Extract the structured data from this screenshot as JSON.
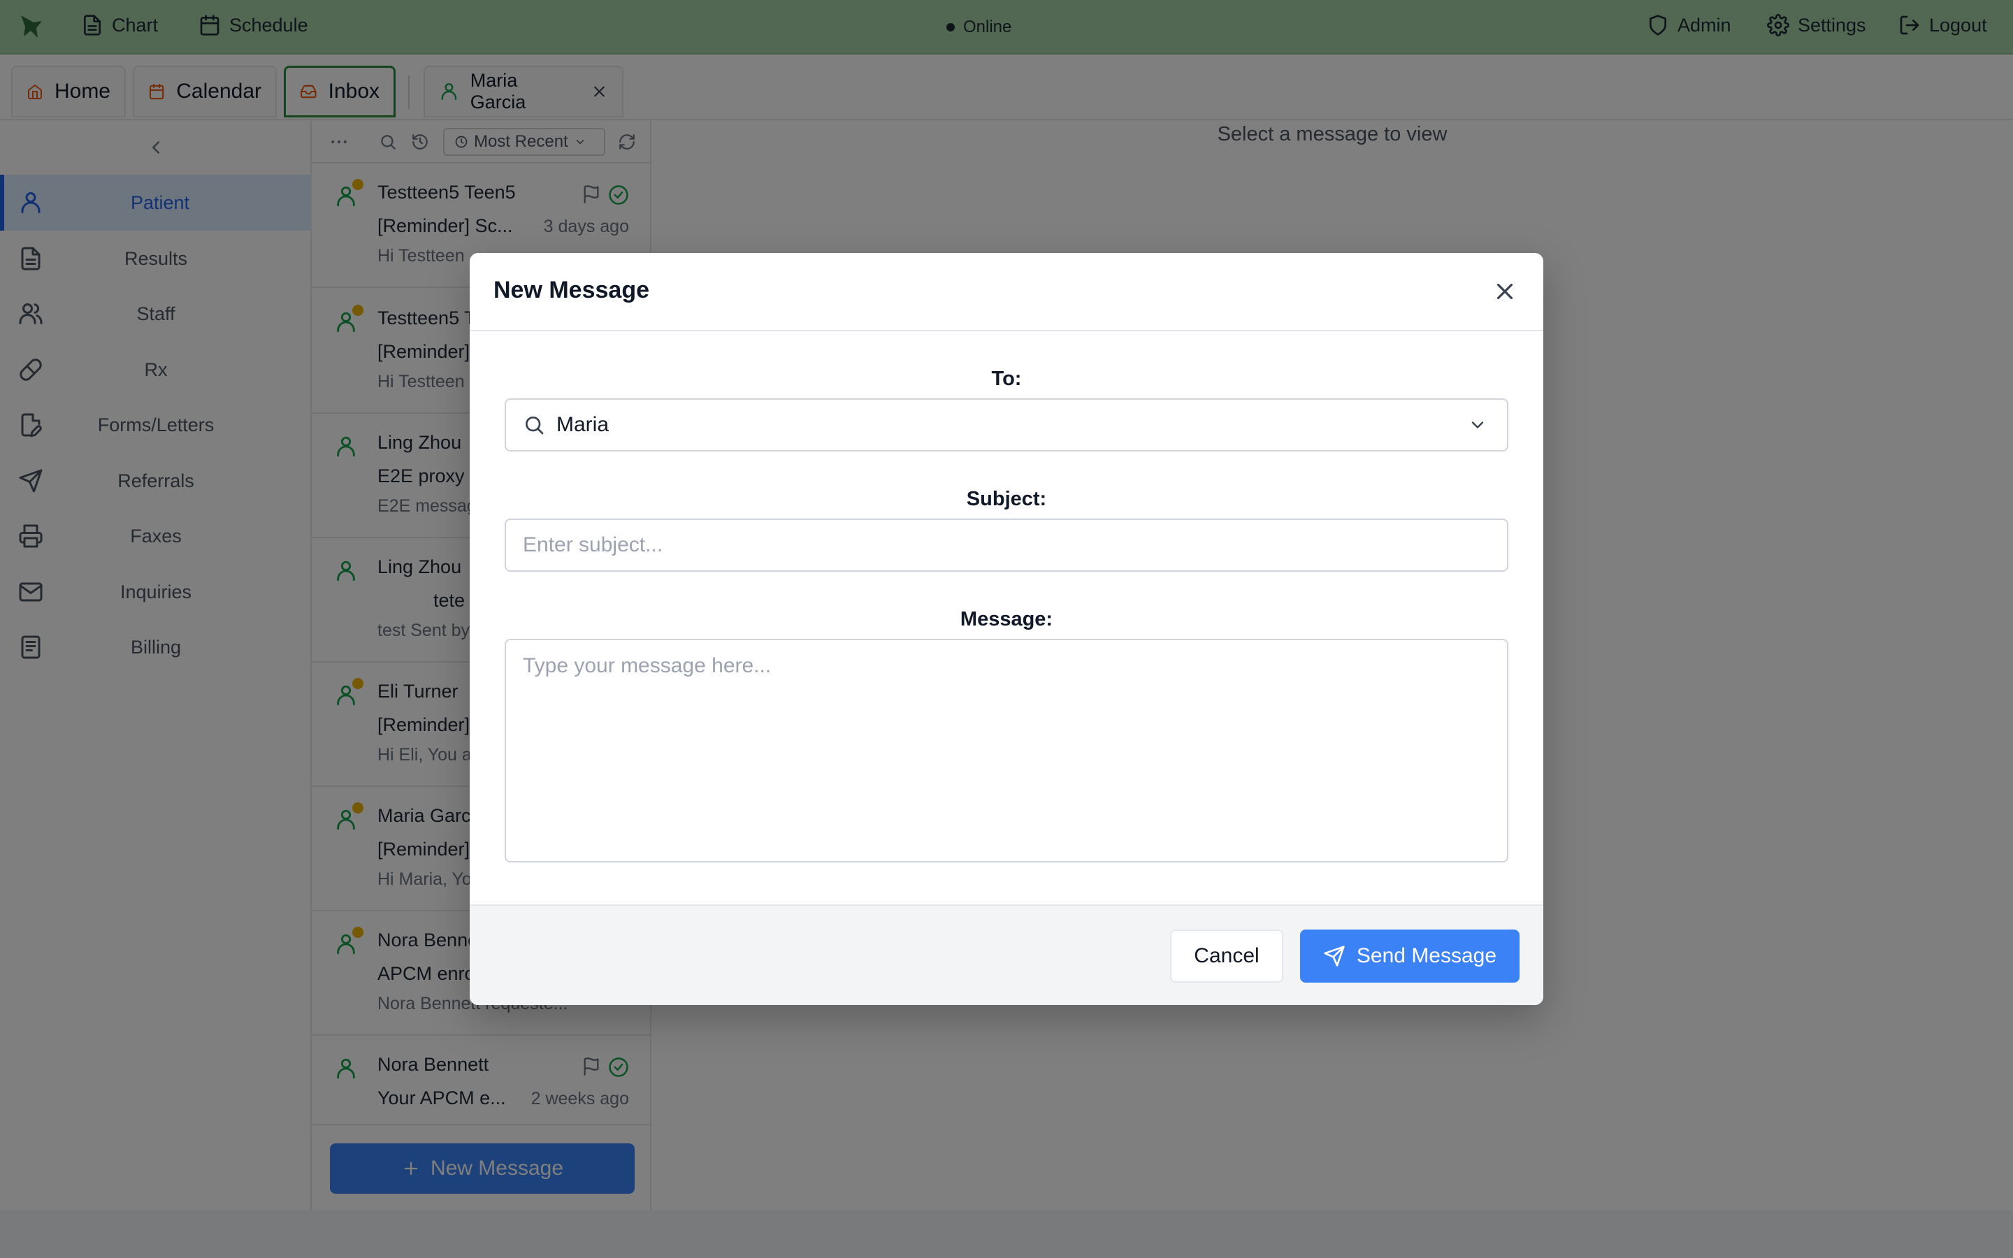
{
  "topbar": {
    "chart_label": "Chart",
    "schedule_label": "Schedule",
    "status": "Online",
    "admin_label": "Admin",
    "settings_label": "Settings",
    "logout_label": "Logout"
  },
  "tabs": [
    {
      "label": "Home"
    },
    {
      "label": "Calendar"
    },
    {
      "label": "Inbox"
    },
    {
      "label": "Maria Garcia"
    }
  ],
  "sidebar": {
    "items": [
      {
        "label": "Patient"
      },
      {
        "label": "Results"
      },
      {
        "label": "Staff"
      },
      {
        "label": "Rx"
      },
      {
        "label": "Forms/Letters"
      },
      {
        "label": "Referrals"
      },
      {
        "label": "Faxes"
      },
      {
        "label": "Inquiries"
      },
      {
        "label": "Billing"
      }
    ]
  },
  "list": {
    "sort_label": "Most Recent",
    "messages": [
      {
        "name": "Testteen5 Teen5",
        "subject": "[Reminder] Sc...",
        "time": "3 days ago",
        "preview": "Hi Testteen"
      },
      {
        "name": "Testteen5 T",
        "subject": "[Reminder]",
        "time": "",
        "preview": "Hi Testteen"
      },
      {
        "name": "Ling Zhou",
        "subject": "E2E proxy",
        "time": "",
        "preview": "E2E messag"
      },
      {
        "name": "Ling Zhou",
        "subject": "tete",
        "time": "",
        "preview": "test Sent by"
      },
      {
        "name": "Eli Turner",
        "subject": "[Reminder]",
        "time": "",
        "preview": "Hi Eli, You a"
      },
      {
        "name": "Maria Garc",
        "subject": "[Reminder]",
        "time": "",
        "preview": "Hi Maria, Yo"
      },
      {
        "name": "Nora Benne",
        "subject": "APCM enro",
        "time": "",
        "preview": "Nora Bennett requeste..."
      },
      {
        "name": "Nora Bennett",
        "subject": "Your APCM e...",
        "time": "2 weeks ago",
        "preview": ""
      }
    ],
    "new_message_label": "New Message"
  },
  "main": {
    "empty_text": "Select a message to view"
  },
  "modal": {
    "title": "New Message",
    "to_label": "To:",
    "to_value": "Maria",
    "subject_label": "Subject:",
    "subject_placeholder": "Enter subject...",
    "message_label": "Message:",
    "message_placeholder": "Type your message here...",
    "cancel_label": "Cancel",
    "send_label": "Send Message"
  },
  "colors": {
    "topbar": "#a6d0a7",
    "accent": "#3b82f6",
    "active_tab_border": "#2f8a3e",
    "unread_dot": "#eab308"
  }
}
